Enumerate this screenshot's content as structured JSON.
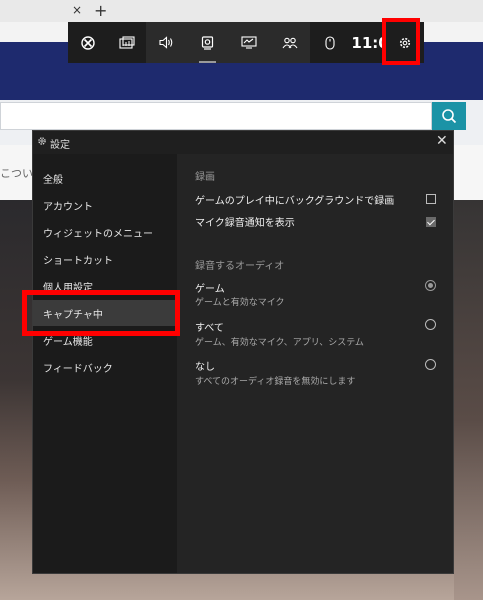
{
  "browser": {
    "tab_close": "×",
    "new_tab": "+",
    "strip_text": "こつい"
  },
  "gamebar": {
    "time": "11:06",
    "buttons": [
      "xbox-icon",
      "widget-menu-icon",
      "audio-icon",
      "capture-icon",
      "performance-icon",
      "social-icon",
      "mouse-icon"
    ]
  },
  "settings": {
    "title": "設定",
    "close": "✕",
    "nav": [
      {
        "label": "全般"
      },
      {
        "label": "アカウント"
      },
      {
        "label": "ウィジェットのメニュー"
      },
      {
        "label": "ショートカット"
      },
      {
        "label": "個人用設定"
      },
      {
        "label": "キャプチャ中"
      },
      {
        "label": "ゲーム機能"
      },
      {
        "label": "フィードバック"
      }
    ],
    "selected_nav": "キャプチャ中",
    "section_record": "録画",
    "options": [
      {
        "label": "ゲームのプレイ中にバックグラウンドで録画",
        "checked": false
      },
      {
        "label": "マイク録音通知を表示",
        "checked": true
      }
    ],
    "section_audio": "録音するオーディオ",
    "audio": [
      {
        "label": "ゲーム",
        "desc": "ゲームと有効なマイク",
        "selected": true
      },
      {
        "label": "すべて",
        "desc": "ゲーム、有効なマイク、アプリ、システム",
        "selected": false
      },
      {
        "label": "なし",
        "desc": "すべてのオーディオ録音を無効にします",
        "selected": false
      }
    ]
  },
  "colors": {
    "highlight_red": "#ff0000",
    "navy_band": "#1e2a6e",
    "search_teal": "#1b93a6"
  }
}
